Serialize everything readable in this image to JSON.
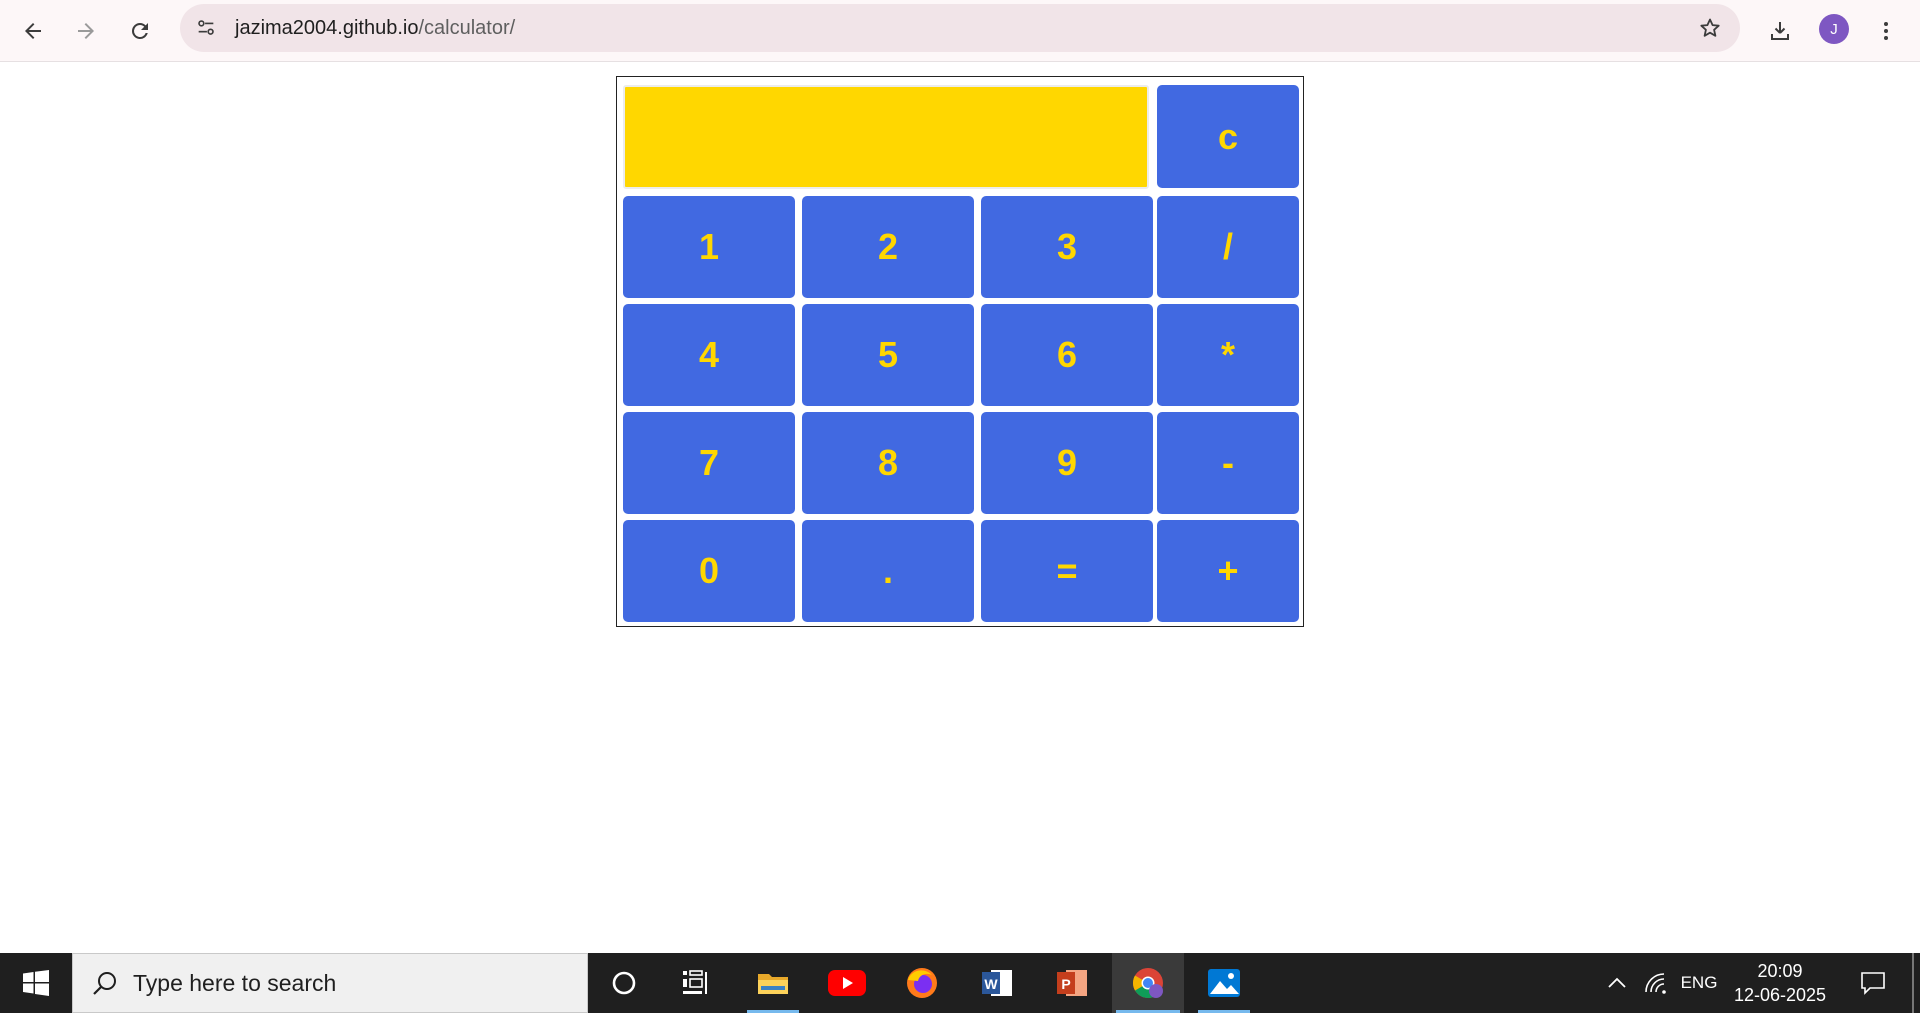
{
  "browser": {
    "url_host": "jazima2004.github.io",
    "url_path": "/calculator/",
    "profile_initial": "J"
  },
  "calculator": {
    "display_value": "",
    "clear_label": "c",
    "rows": [
      [
        {
          "label": "1",
          "name": "key-1"
        },
        {
          "label": "2",
          "name": "key-2"
        },
        {
          "label": "3",
          "name": "key-3"
        },
        {
          "label": "/",
          "name": "key-divide"
        }
      ],
      [
        {
          "label": "4",
          "name": "key-4"
        },
        {
          "label": "5",
          "name": "key-5"
        },
        {
          "label": "6",
          "name": "key-6"
        },
        {
          "label": "*",
          "name": "key-multiply"
        }
      ],
      [
        {
          "label": "7",
          "name": "key-7"
        },
        {
          "label": "8",
          "name": "key-8"
        },
        {
          "label": "9",
          "name": "key-9"
        },
        {
          "label": "-",
          "name": "key-subtract"
        }
      ],
      [
        {
          "label": "0",
          "name": "key-0"
        },
        {
          "label": ".",
          "name": "key-decimal"
        },
        {
          "label": "=",
          "name": "key-equals"
        },
        {
          "label": "+",
          "name": "key-add"
        }
      ]
    ],
    "colors": {
      "display_bg": "#ffd700",
      "key_bg": "#4169e1",
      "key_text": "#ffd700"
    }
  },
  "taskbar": {
    "search_placeholder": "Type here to search",
    "language": "ENG",
    "time": "20:09",
    "date": "12-06-2025"
  }
}
